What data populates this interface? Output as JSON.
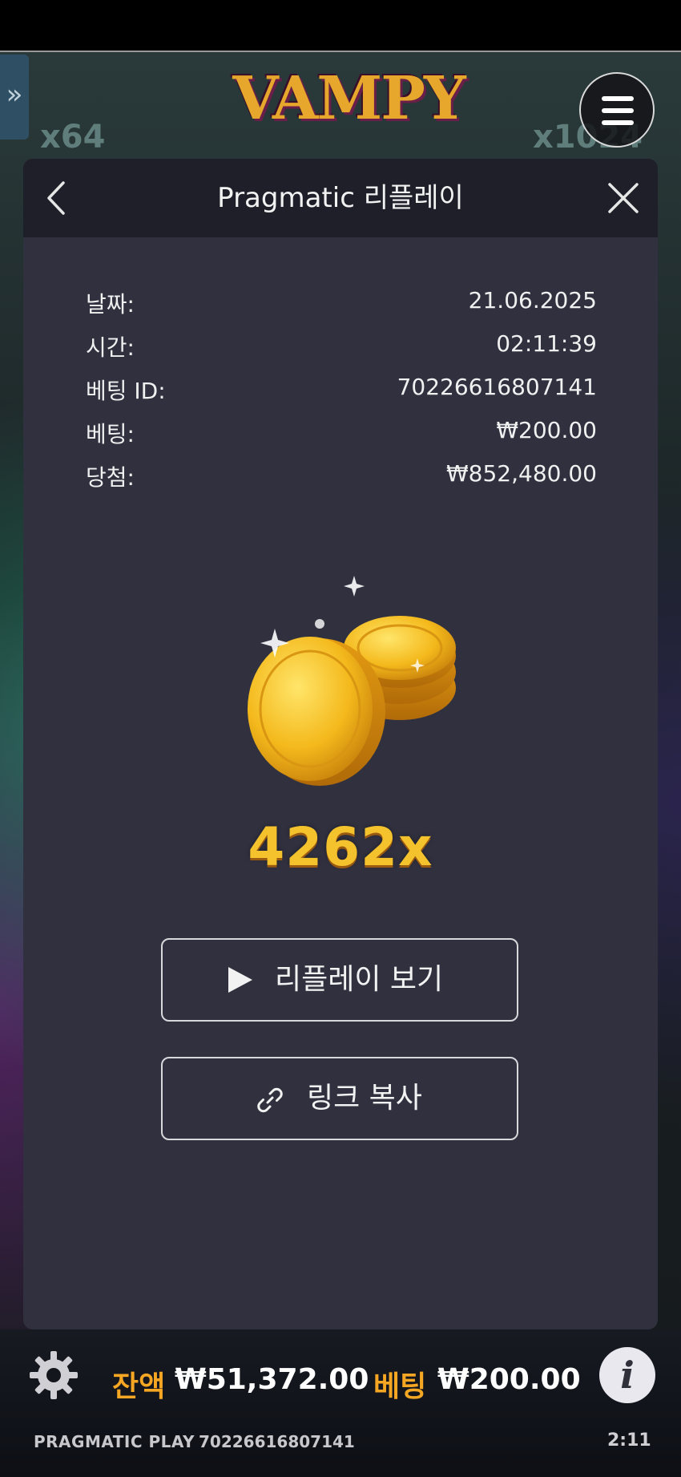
{
  "game": {
    "logo_text": "VAMPY",
    "multiplier_left": "x64",
    "multiplier_right": "x1024"
  },
  "modal": {
    "title": "Pragmatic 리플레이",
    "rows": [
      {
        "label": "날짜:",
        "value": "21.06.2025"
      },
      {
        "label": "시간:",
        "value": "02:11:39"
      },
      {
        "label": "베팅 ID:",
        "value": "70226616807141"
      },
      {
        "label": "베팅:",
        "value": "₩200.00"
      },
      {
        "label": "당첨:",
        "value": "₩852,480.00"
      }
    ],
    "multiplier": "4262x",
    "replay_button": "리플레이 보기",
    "copy_link_button": "링크 복사"
  },
  "footer": {
    "balance_label": "잔액",
    "balance_value": "₩51,372.00",
    "bet_label": "베팅",
    "bet_value": "₩200.00",
    "brand": "PRAGMATIC PLAY",
    "bet_id": "70226616807141",
    "clock": "2:11"
  },
  "colors": {
    "modal_bg": "#30303f",
    "header_bg": "#1f1f29",
    "gold": "#f4c22c",
    "label_orange": "#f5a623"
  },
  "icons": [
    "double-chevron-right-icon",
    "hamburger-menu-icon",
    "back-chevron-icon",
    "close-icon",
    "coins-icon",
    "play-icon",
    "link-icon",
    "gear-icon",
    "info-icon"
  ]
}
